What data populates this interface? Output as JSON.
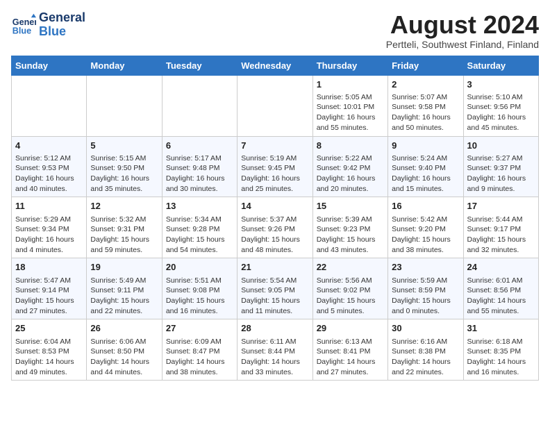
{
  "header": {
    "logo_line1": "General",
    "logo_line2": "Blue",
    "month_title": "August 2024",
    "subtitle": "Pertteli, Southwest Finland, Finland"
  },
  "weekdays": [
    "Sunday",
    "Monday",
    "Tuesday",
    "Wednesday",
    "Thursday",
    "Friday",
    "Saturday"
  ],
  "weeks": [
    [
      {
        "day": "",
        "info": ""
      },
      {
        "day": "",
        "info": ""
      },
      {
        "day": "",
        "info": ""
      },
      {
        "day": "",
        "info": ""
      },
      {
        "day": "1",
        "info": "Sunrise: 5:05 AM\nSunset: 10:01 PM\nDaylight: 16 hours\nand 55 minutes."
      },
      {
        "day": "2",
        "info": "Sunrise: 5:07 AM\nSunset: 9:58 PM\nDaylight: 16 hours\nand 50 minutes."
      },
      {
        "day": "3",
        "info": "Sunrise: 5:10 AM\nSunset: 9:56 PM\nDaylight: 16 hours\nand 45 minutes."
      }
    ],
    [
      {
        "day": "4",
        "info": "Sunrise: 5:12 AM\nSunset: 9:53 PM\nDaylight: 16 hours\nand 40 minutes."
      },
      {
        "day": "5",
        "info": "Sunrise: 5:15 AM\nSunset: 9:50 PM\nDaylight: 16 hours\nand 35 minutes."
      },
      {
        "day": "6",
        "info": "Sunrise: 5:17 AM\nSunset: 9:48 PM\nDaylight: 16 hours\nand 30 minutes."
      },
      {
        "day": "7",
        "info": "Sunrise: 5:19 AM\nSunset: 9:45 PM\nDaylight: 16 hours\nand 25 minutes."
      },
      {
        "day": "8",
        "info": "Sunrise: 5:22 AM\nSunset: 9:42 PM\nDaylight: 16 hours\nand 20 minutes."
      },
      {
        "day": "9",
        "info": "Sunrise: 5:24 AM\nSunset: 9:40 PM\nDaylight: 16 hours\nand 15 minutes."
      },
      {
        "day": "10",
        "info": "Sunrise: 5:27 AM\nSunset: 9:37 PM\nDaylight: 16 hours\nand 9 minutes."
      }
    ],
    [
      {
        "day": "11",
        "info": "Sunrise: 5:29 AM\nSunset: 9:34 PM\nDaylight: 16 hours\nand 4 minutes."
      },
      {
        "day": "12",
        "info": "Sunrise: 5:32 AM\nSunset: 9:31 PM\nDaylight: 15 hours\nand 59 minutes."
      },
      {
        "day": "13",
        "info": "Sunrise: 5:34 AM\nSunset: 9:28 PM\nDaylight: 15 hours\nand 54 minutes."
      },
      {
        "day": "14",
        "info": "Sunrise: 5:37 AM\nSunset: 9:26 PM\nDaylight: 15 hours\nand 48 minutes."
      },
      {
        "day": "15",
        "info": "Sunrise: 5:39 AM\nSunset: 9:23 PM\nDaylight: 15 hours\nand 43 minutes."
      },
      {
        "day": "16",
        "info": "Sunrise: 5:42 AM\nSunset: 9:20 PM\nDaylight: 15 hours\nand 38 minutes."
      },
      {
        "day": "17",
        "info": "Sunrise: 5:44 AM\nSunset: 9:17 PM\nDaylight: 15 hours\nand 32 minutes."
      }
    ],
    [
      {
        "day": "18",
        "info": "Sunrise: 5:47 AM\nSunset: 9:14 PM\nDaylight: 15 hours\nand 27 minutes."
      },
      {
        "day": "19",
        "info": "Sunrise: 5:49 AM\nSunset: 9:11 PM\nDaylight: 15 hours\nand 22 minutes."
      },
      {
        "day": "20",
        "info": "Sunrise: 5:51 AM\nSunset: 9:08 PM\nDaylight: 15 hours\nand 16 minutes."
      },
      {
        "day": "21",
        "info": "Sunrise: 5:54 AM\nSunset: 9:05 PM\nDaylight: 15 hours\nand 11 minutes."
      },
      {
        "day": "22",
        "info": "Sunrise: 5:56 AM\nSunset: 9:02 PM\nDaylight: 15 hours\nand 5 minutes."
      },
      {
        "day": "23",
        "info": "Sunrise: 5:59 AM\nSunset: 8:59 PM\nDaylight: 15 hours\nand 0 minutes."
      },
      {
        "day": "24",
        "info": "Sunrise: 6:01 AM\nSunset: 8:56 PM\nDaylight: 14 hours\nand 55 minutes."
      }
    ],
    [
      {
        "day": "25",
        "info": "Sunrise: 6:04 AM\nSunset: 8:53 PM\nDaylight: 14 hours\nand 49 minutes."
      },
      {
        "day": "26",
        "info": "Sunrise: 6:06 AM\nSunset: 8:50 PM\nDaylight: 14 hours\nand 44 minutes."
      },
      {
        "day": "27",
        "info": "Sunrise: 6:09 AM\nSunset: 8:47 PM\nDaylight: 14 hours\nand 38 minutes."
      },
      {
        "day": "28",
        "info": "Sunrise: 6:11 AM\nSunset: 8:44 PM\nDaylight: 14 hours\nand 33 minutes."
      },
      {
        "day": "29",
        "info": "Sunrise: 6:13 AM\nSunset: 8:41 PM\nDaylight: 14 hours\nand 27 minutes."
      },
      {
        "day": "30",
        "info": "Sunrise: 6:16 AM\nSunset: 8:38 PM\nDaylight: 14 hours\nand 22 minutes."
      },
      {
        "day": "31",
        "info": "Sunrise: 6:18 AM\nSunset: 8:35 PM\nDaylight: 14 hours\nand 16 minutes."
      }
    ]
  ]
}
